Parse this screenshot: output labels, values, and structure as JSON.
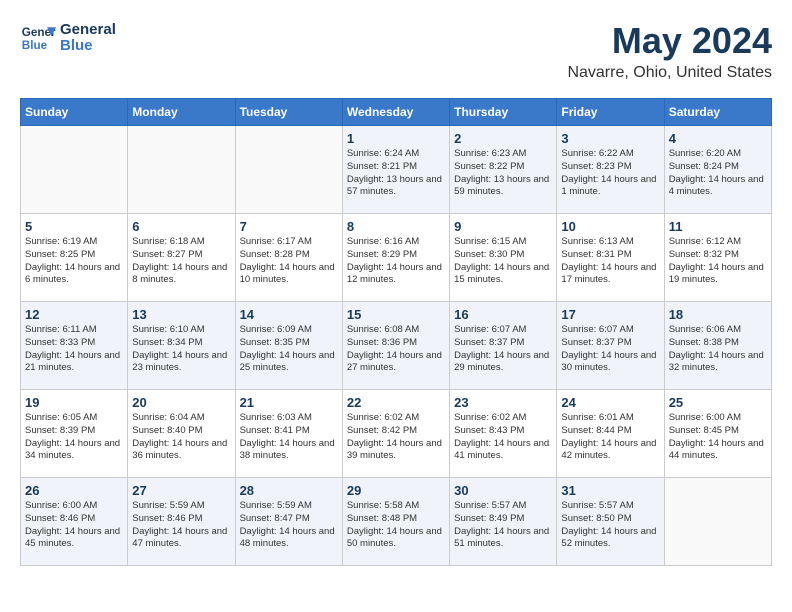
{
  "header": {
    "logo_line1": "General",
    "logo_line2": "Blue",
    "month": "May 2024",
    "location": "Navarre, Ohio, United States"
  },
  "weekdays": [
    "Sunday",
    "Monday",
    "Tuesday",
    "Wednesday",
    "Thursday",
    "Friday",
    "Saturday"
  ],
  "weeks": [
    [
      {
        "day": "",
        "sunrise": "",
        "sunset": "",
        "daylight": ""
      },
      {
        "day": "",
        "sunrise": "",
        "sunset": "",
        "daylight": ""
      },
      {
        "day": "",
        "sunrise": "",
        "sunset": "",
        "daylight": ""
      },
      {
        "day": "1",
        "sunrise": "Sunrise: 6:24 AM",
        "sunset": "Sunset: 8:21 PM",
        "daylight": "Daylight: 13 hours and 57 minutes."
      },
      {
        "day": "2",
        "sunrise": "Sunrise: 6:23 AM",
        "sunset": "Sunset: 8:22 PM",
        "daylight": "Daylight: 13 hours and 59 minutes."
      },
      {
        "day": "3",
        "sunrise": "Sunrise: 6:22 AM",
        "sunset": "Sunset: 8:23 PM",
        "daylight": "Daylight: 14 hours and 1 minute."
      },
      {
        "day": "4",
        "sunrise": "Sunrise: 6:20 AM",
        "sunset": "Sunset: 8:24 PM",
        "daylight": "Daylight: 14 hours and 4 minutes."
      }
    ],
    [
      {
        "day": "5",
        "sunrise": "Sunrise: 6:19 AM",
        "sunset": "Sunset: 8:25 PM",
        "daylight": "Daylight: 14 hours and 6 minutes."
      },
      {
        "day": "6",
        "sunrise": "Sunrise: 6:18 AM",
        "sunset": "Sunset: 8:27 PM",
        "daylight": "Daylight: 14 hours and 8 minutes."
      },
      {
        "day": "7",
        "sunrise": "Sunrise: 6:17 AM",
        "sunset": "Sunset: 8:28 PM",
        "daylight": "Daylight: 14 hours and 10 minutes."
      },
      {
        "day": "8",
        "sunrise": "Sunrise: 6:16 AM",
        "sunset": "Sunset: 8:29 PM",
        "daylight": "Daylight: 14 hours and 12 minutes."
      },
      {
        "day": "9",
        "sunrise": "Sunrise: 6:15 AM",
        "sunset": "Sunset: 8:30 PM",
        "daylight": "Daylight: 14 hours and 15 minutes."
      },
      {
        "day": "10",
        "sunrise": "Sunrise: 6:13 AM",
        "sunset": "Sunset: 8:31 PM",
        "daylight": "Daylight: 14 hours and 17 minutes."
      },
      {
        "day": "11",
        "sunrise": "Sunrise: 6:12 AM",
        "sunset": "Sunset: 8:32 PM",
        "daylight": "Daylight: 14 hours and 19 minutes."
      }
    ],
    [
      {
        "day": "12",
        "sunrise": "Sunrise: 6:11 AM",
        "sunset": "Sunset: 8:33 PM",
        "daylight": "Daylight: 14 hours and 21 minutes."
      },
      {
        "day": "13",
        "sunrise": "Sunrise: 6:10 AM",
        "sunset": "Sunset: 8:34 PM",
        "daylight": "Daylight: 14 hours and 23 minutes."
      },
      {
        "day": "14",
        "sunrise": "Sunrise: 6:09 AM",
        "sunset": "Sunset: 8:35 PM",
        "daylight": "Daylight: 14 hours and 25 minutes."
      },
      {
        "day": "15",
        "sunrise": "Sunrise: 6:08 AM",
        "sunset": "Sunset: 8:36 PM",
        "daylight": "Daylight: 14 hours and 27 minutes."
      },
      {
        "day": "16",
        "sunrise": "Sunrise: 6:07 AM",
        "sunset": "Sunset: 8:37 PM",
        "daylight": "Daylight: 14 hours and 29 minutes."
      },
      {
        "day": "17",
        "sunrise": "Sunrise: 6:07 AM",
        "sunset": "Sunset: 8:37 PM",
        "daylight": "Daylight: 14 hours and 30 minutes."
      },
      {
        "day": "18",
        "sunrise": "Sunrise: 6:06 AM",
        "sunset": "Sunset: 8:38 PM",
        "daylight": "Daylight: 14 hours and 32 minutes."
      }
    ],
    [
      {
        "day": "19",
        "sunrise": "Sunrise: 6:05 AM",
        "sunset": "Sunset: 8:39 PM",
        "daylight": "Daylight: 14 hours and 34 minutes."
      },
      {
        "day": "20",
        "sunrise": "Sunrise: 6:04 AM",
        "sunset": "Sunset: 8:40 PM",
        "daylight": "Daylight: 14 hours and 36 minutes."
      },
      {
        "day": "21",
        "sunrise": "Sunrise: 6:03 AM",
        "sunset": "Sunset: 8:41 PM",
        "daylight": "Daylight: 14 hours and 38 minutes."
      },
      {
        "day": "22",
        "sunrise": "Sunrise: 6:02 AM",
        "sunset": "Sunset: 8:42 PM",
        "daylight": "Daylight: 14 hours and 39 minutes."
      },
      {
        "day": "23",
        "sunrise": "Sunrise: 6:02 AM",
        "sunset": "Sunset: 8:43 PM",
        "daylight": "Daylight: 14 hours and 41 minutes."
      },
      {
        "day": "24",
        "sunrise": "Sunrise: 6:01 AM",
        "sunset": "Sunset: 8:44 PM",
        "daylight": "Daylight: 14 hours and 42 minutes."
      },
      {
        "day": "25",
        "sunrise": "Sunrise: 6:00 AM",
        "sunset": "Sunset: 8:45 PM",
        "daylight": "Daylight: 14 hours and 44 minutes."
      }
    ],
    [
      {
        "day": "26",
        "sunrise": "Sunrise: 6:00 AM",
        "sunset": "Sunset: 8:46 PM",
        "daylight": "Daylight: 14 hours and 45 minutes."
      },
      {
        "day": "27",
        "sunrise": "Sunrise: 5:59 AM",
        "sunset": "Sunset: 8:46 PM",
        "daylight": "Daylight: 14 hours and 47 minutes."
      },
      {
        "day": "28",
        "sunrise": "Sunrise: 5:59 AM",
        "sunset": "Sunset: 8:47 PM",
        "daylight": "Daylight: 14 hours and 48 minutes."
      },
      {
        "day": "29",
        "sunrise": "Sunrise: 5:58 AM",
        "sunset": "Sunset: 8:48 PM",
        "daylight": "Daylight: 14 hours and 50 minutes."
      },
      {
        "day": "30",
        "sunrise": "Sunrise: 5:57 AM",
        "sunset": "Sunset: 8:49 PM",
        "daylight": "Daylight: 14 hours and 51 minutes."
      },
      {
        "day": "31",
        "sunrise": "Sunrise: 5:57 AM",
        "sunset": "Sunset: 8:50 PM",
        "daylight": "Daylight: 14 hours and 52 minutes."
      },
      {
        "day": "",
        "sunrise": "",
        "sunset": "",
        "daylight": ""
      }
    ]
  ]
}
